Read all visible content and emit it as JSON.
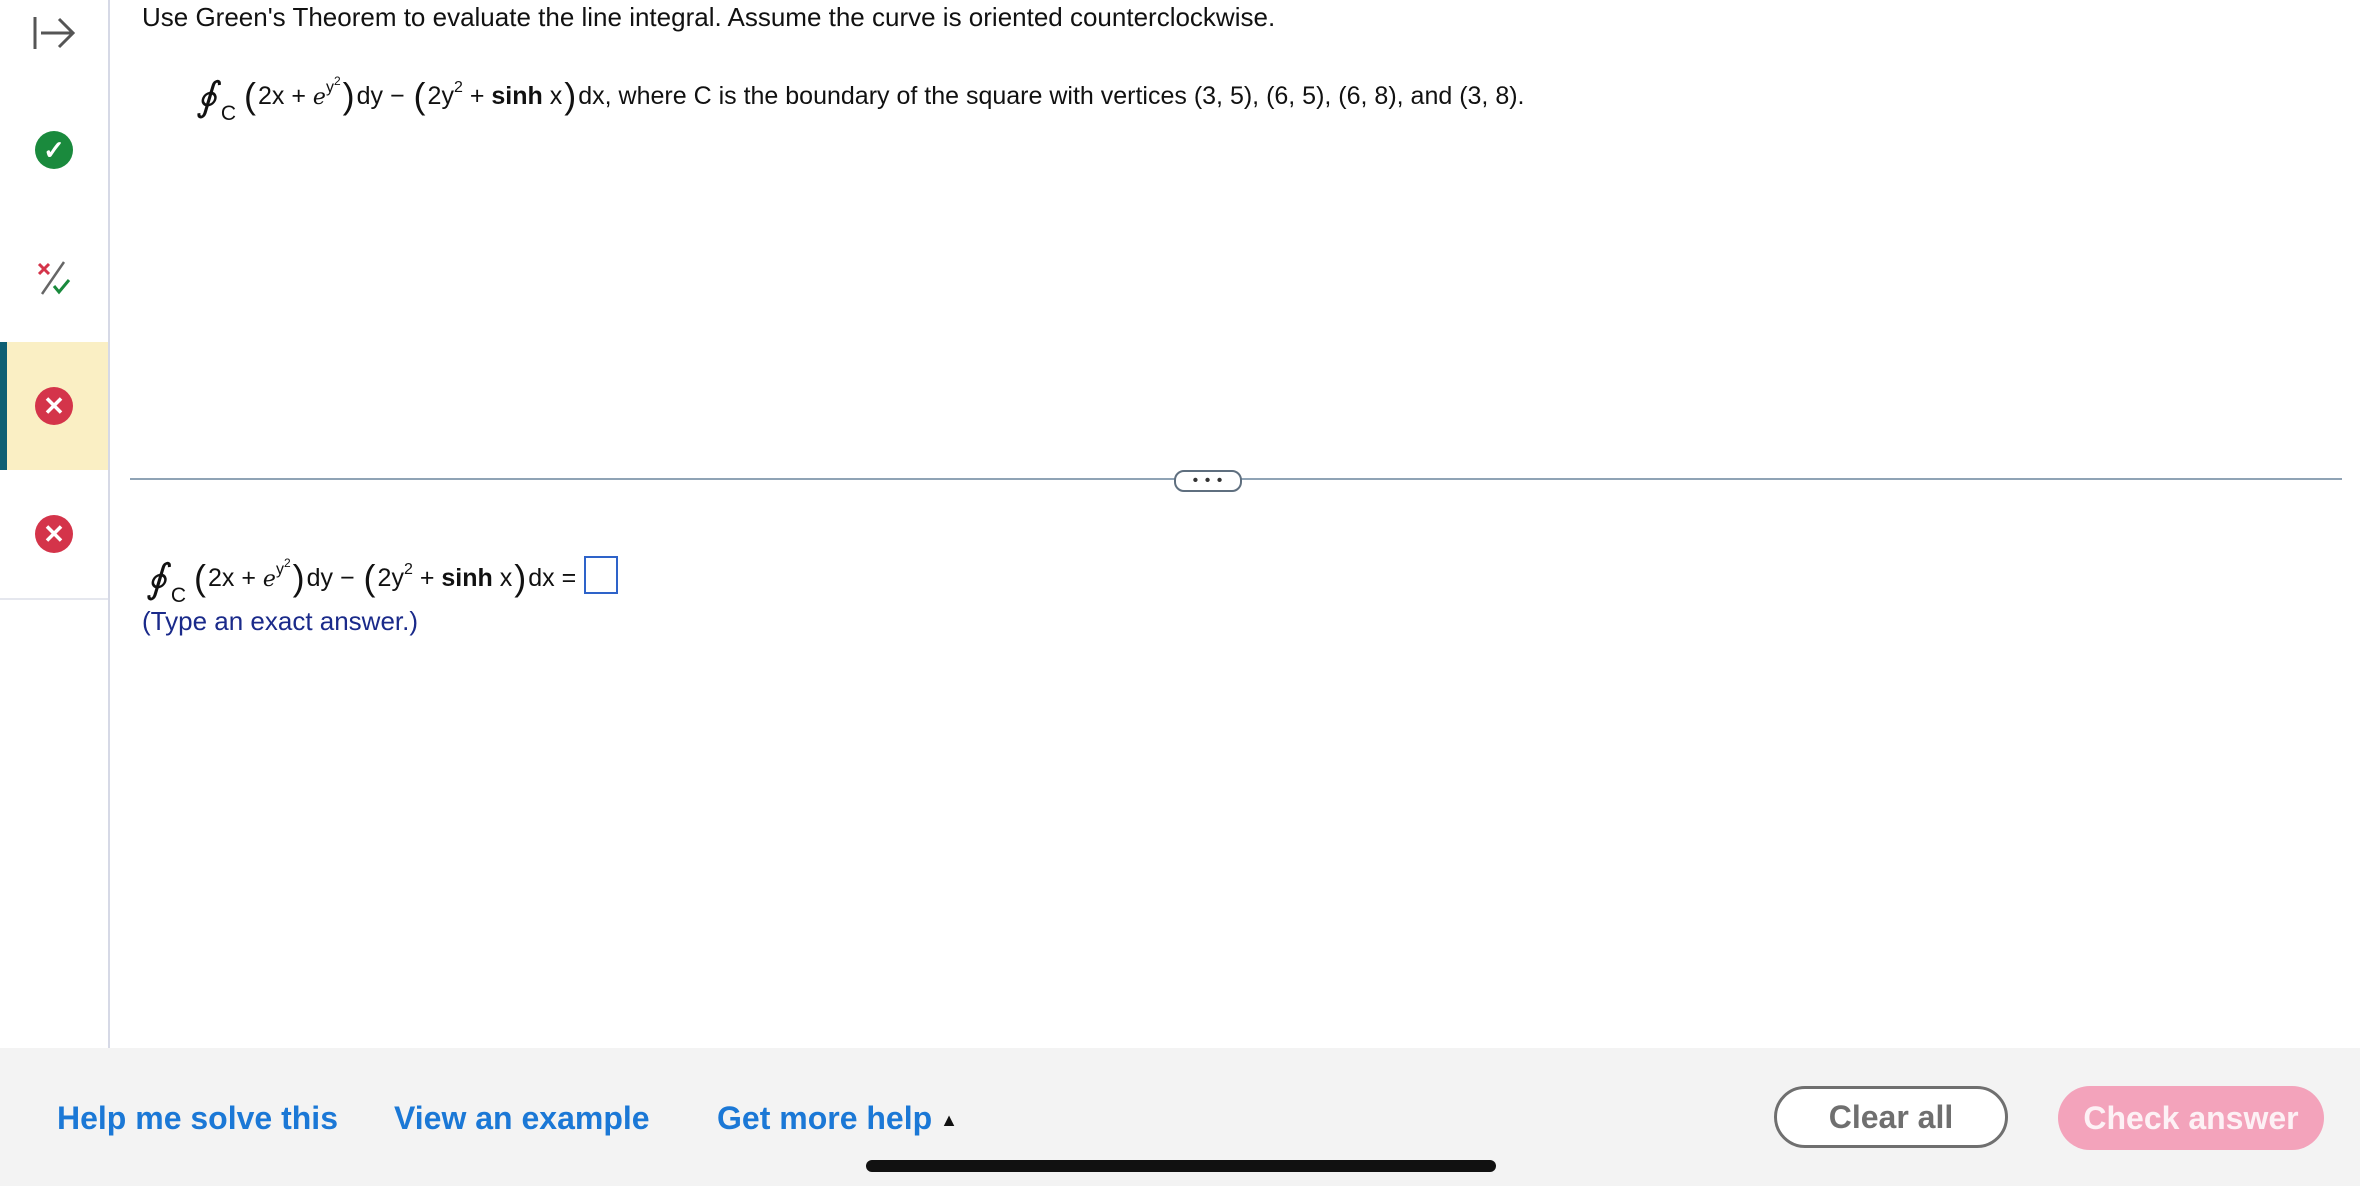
{
  "question": {
    "prompt": "Use Green's Theorem to evaluate the line integral. Assume the curve is oriented counterclockwise.",
    "integral_symbol": "∮",
    "integral_subscript": "C",
    "t_2x": "2x +",
    "t_e": "e",
    "t_y": "y",
    "t_sq": "2",
    "t_dy": "dy −",
    "t_2y": "2y",
    "t_plus": "+",
    "t_sinh": "sinh",
    "t_x": "x",
    "t_dx_tail": "dx, where C is the boundary of the square with vertices (3, 5), (6, 5), (6, 8), and (3, 8)."
  },
  "answer": {
    "t_dx_eq": "dx =",
    "hint": "(Type an exact answer.)"
  },
  "divider": {
    "handle_label": "• • •"
  },
  "footer": {
    "help_me_solve": "Help me solve this",
    "view_example": "View an example",
    "get_more_help": "Get more help",
    "clear_all": "Clear all",
    "check_answer": "Check answer"
  },
  "sidebar": {
    "items": [
      {
        "status": "correct",
        "symbol": "✓"
      },
      {
        "status": "partially-correct"
      },
      {
        "status": "incorrect",
        "symbol": "✕",
        "selected": true
      },
      {
        "status": "incorrect",
        "symbol": "✕"
      }
    ]
  },
  "colors": {
    "link_blue": "#1b78d6",
    "correct_green": "#1a8a3d",
    "incorrect_red": "#d4344a",
    "selected_bg": "#faefc4",
    "selected_bar": "#0e5f74",
    "check_answer_bg": "#f3a3bb"
  }
}
